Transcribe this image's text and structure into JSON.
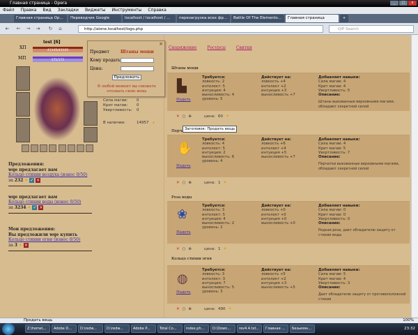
{
  "window": {
    "title": "Главная страница - Opera"
  },
  "menu": [
    "Файл",
    "Правка",
    "Вид",
    "Закладки",
    "Виджеты",
    "Инструменты",
    "Справка"
  ],
  "tabs": [
    {
      "label": "Главная страница Op..."
    },
    {
      "label": "Переводчик Google"
    },
    {
      "label": "localhost / localhost / ..."
    },
    {
      "label": "перезагрузка всех фр..."
    },
    {
      "label": "Battle Of The Elements..."
    },
    {
      "label": "Главная страница",
      "active": true
    }
  ],
  "address": {
    "url": "http://alone.localhost/logo.php",
    "search_placeholder": "QIP Search"
  },
  "character": {
    "name": "test [6]",
    "hp_label": "ХП",
    "mp_label": "МП",
    "hp": "41145/43105",
    "mp": "171/171",
    "stats": [
      "Сила магии:",
      "Крит магии:",
      "Увертливость:"
    ],
    "stat_values": [
      "0",
      "0",
      "0"
    ],
    "gold_label": "В наличии:",
    "gold": "14957"
  },
  "popup": {
    "item_label": "Предмет",
    "item_name": "Штаны мощи",
    "to_label": "Кому продать:",
    "price_label": "Цена:",
    "submit": "Предложить",
    "note": "В любой момент вы сможете отозвать свою вещь",
    "close": "×"
  },
  "offers": {
    "title": "Предложения:",
    "list": [
      {
        "from": "wqe предлагает вам",
        "item": "Кольцо стихии воздуха (износ 0/50)",
        "price_prefix": "за",
        "price": "232"
      },
      {
        "from": "wqe предлагает вам",
        "item": "Кольцо стихии воды (износ 0/50)",
        "price_prefix": "за",
        "price": "3234"
      }
    ]
  },
  "my_offers": {
    "title": "Мои предложения:",
    "list": [
      {
        "from": "Вы предложили wqe купить",
        "item": "Кольцо стихии огня (износ 0/50)",
        "price_prefix": "за",
        "price": "3"
      }
    ]
  },
  "topnav": [
    "Снаряжение",
    "Ресурсы",
    "Свитки"
  ],
  "labels": {
    "req": "Требуется:",
    "acts": "Действует на:",
    "adds": "Добавляет навыки:",
    "desc": "Описание:",
    "wear": "Надеть",
    "price": "цена:"
  },
  "items": [
    {
      "name": "Штаны мощи",
      "req": [
        "ловкость: 2",
        "интелект: 5",
        "интуиция: 4",
        "выносливость: 4",
        "уровень: 5"
      ],
      "acts": [
        "ловкость +4",
        "интелект +2",
        "интуиция +3",
        "выносливость +7"
      ],
      "adds": [
        "Сила магии: 4",
        "Крит магии: 4",
        "Увертливость: 5"
      ],
      "desc": "Штаны выкованные верховными магами, обладают секретной силой",
      "price": "60"
    },
    {
      "name": "Перчатки мощи",
      "req": [
        "ловкость: 4",
        "интелект: 5",
        "интуиция: 2",
        "выносливость: 6",
        "уровень: 4"
      ],
      "acts": [
        "ловкость +6",
        "интелект +4",
        "интуиция +5",
        "выносливость +7"
      ],
      "adds": [
        "Сила магии: 4",
        "Крит магии: 5",
        "Увертливость: 7"
      ],
      "desc": "Перчатки выкованные верховными магами, обладают секретной силой",
      "price": "1"
    },
    {
      "name": "Роза воды",
      "req": [
        "ловкость: 3",
        "интелект: 5",
        "интуиция: 4",
        "выносливость: 2",
        "уровень: 2"
      ],
      "acts": [
        "ловкость +0",
        "интелект +0",
        "интуиция +0",
        "выносливость +0"
      ],
      "adds": [
        "Сила магии: 0",
        "Крит магии: 0",
        "Увертливость: 0"
      ],
      "desc": "Редкая роза, дает обладателю защиту от стихии воды",
      "price": "1"
    },
    {
      "name": "Кольцо стихии огня",
      "req": [
        "ловкость: 3",
        "интелект: 3",
        "интуиция: 7",
        "выносливость: 5",
        "уровень: 3"
      ],
      "acts": [
        "ловкость +5",
        "интелект +2",
        "интуиция +3",
        "выносливость +5"
      ],
      "adds": [
        "Сила магии: 5",
        "Крит магии: 4",
        "Увертливость: 3"
      ],
      "desc": "Дает обладателю защиту от противоположной стихии",
      "price": "490"
    }
  ],
  "tooltip": "Заголовок: Продать вещь",
  "status": {
    "text": "Продать вещь",
    "zoom": "100%"
  },
  "taskbar": {
    "items": [
      "Z:\\home\\...",
      "Adobe D...",
      "D:\\redw...",
      "D:\\redw...",
      "Adobe P...",
      "Total Co...",
      "index.ph...",
      "D:\\Down...",
      "rev4.4.txt...",
      "Главная ...",
      "Безымян..."
    ],
    "clock": "23:32"
  },
  "colors": {
    "accent_link": "#3a2aa8",
    "nav_link": "#b01a6a",
    "item_name": "#b0301a"
  }
}
